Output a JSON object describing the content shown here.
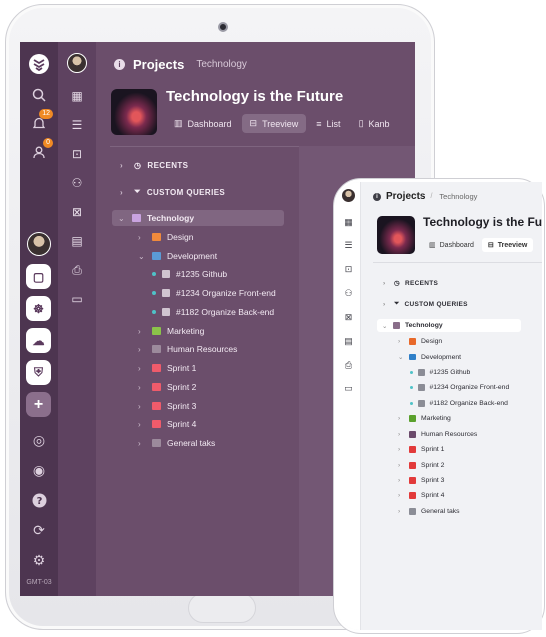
{
  "breadcrumb": {
    "title": "Projects",
    "separator": "/",
    "current": "Technology"
  },
  "project": {
    "title": "Technology is the Future",
    "tabs": [
      {
        "icon": "dashboard-icon",
        "label": "Dashboard"
      },
      {
        "icon": "treeview-icon",
        "label": "Treeview",
        "active": true
      },
      {
        "icon": "list-icon",
        "label": "List"
      },
      {
        "icon": "kanban-icon",
        "label": "Kanb"
      }
    ]
  },
  "rail": {
    "notifications_count": "12",
    "invites_count": "0",
    "timezone": "GMT-03"
  },
  "tree": {
    "recents": "RECENTS",
    "custom_queries": "CUSTOM QUERIES",
    "root": "Technology",
    "folders": [
      {
        "label": "Design",
        "color": "#f08a3c"
      },
      {
        "label": "Development",
        "color": "#5b9bd5",
        "expanded": true,
        "tasks": [
          "#1235 Github",
          "#1234 Organize Front-end",
          "#1182 Organize Back-end"
        ]
      },
      {
        "label": "Marketing",
        "color": "#8bc34a"
      },
      {
        "label": "Human Resources",
        "color": "#9c8a9c"
      },
      {
        "label": "Sprint 1",
        "color": "#ef5b6b"
      },
      {
        "label": "Sprint 2",
        "color": "#ef5b6b"
      },
      {
        "label": "Sprint 3",
        "color": "#ef5b6b"
      },
      {
        "label": "Sprint 4",
        "color": "#ef5b6b"
      },
      {
        "label": "General taks",
        "color": "#9c8a9c"
      }
    ]
  },
  "phone": {
    "folder_colors": [
      "#e8692a",
      "#2f7fc8",
      "#5aa02c",
      "#6b4a6b",
      "#e23a3a",
      "#e23a3a",
      "#e23a3a",
      "#e23a3a",
      "#8b8d96"
    ],
    "root_color": "#8a6e8a"
  }
}
